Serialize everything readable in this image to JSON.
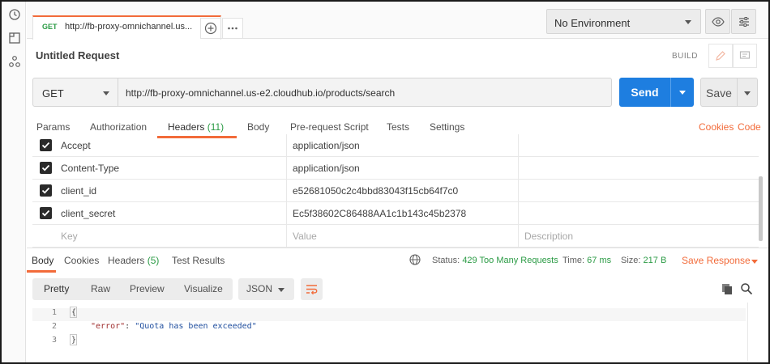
{
  "rail": {
    "icons": [
      "history-icon",
      "collection-icon",
      "apis-icon"
    ]
  },
  "tab": {
    "method": "GET",
    "url": "http://fb-proxy-omnichannel.us..."
  },
  "environment": {
    "selected": "No Environment"
  },
  "request": {
    "title": "Untitled Request",
    "build_label": "BUILD",
    "method": "GET",
    "url": "http://fb-proxy-omnichannel.us-e2.cloudhub.io/products/search",
    "send_label": "Send",
    "save_label": "Save"
  },
  "request_tabs": {
    "params": "Params",
    "authorization": "Authorization",
    "headers": "Headers",
    "headers_count": "(11)",
    "body": "Body",
    "pre_request": "Pre-request Script",
    "tests": "Tests",
    "settings": "Settings",
    "cookies": "Cookies",
    "code": "Code"
  },
  "headers": {
    "rows": [
      {
        "key": "Accept",
        "value": "application/json"
      },
      {
        "key": "Content-Type",
        "value": "application/json"
      },
      {
        "key": "client_id",
        "value": "e52681050c2c4bbd83043f15cb64f7c0"
      },
      {
        "key": "client_secret",
        "value": "Ec5f38602C86488AA1c1b143c45b2378"
      }
    ],
    "placeholder_key": "Key",
    "placeholder_value": "Value",
    "placeholder_description": "Description"
  },
  "response_tabs": {
    "body": "Body",
    "cookies": "Cookies",
    "headers": "Headers",
    "headers_count": "(5)",
    "test_results": "Test Results"
  },
  "response_status": {
    "status_label": "Status:",
    "status_value": "429 Too Many Requests",
    "time_label": "Time:",
    "time_value": "67 ms",
    "size_label": "Size:",
    "size_value": "217 B",
    "save_response": "Save Response"
  },
  "response_view": {
    "modes": [
      "Pretty",
      "Raw",
      "Preview",
      "Visualize"
    ],
    "active_mode": "Pretty",
    "format": "JSON"
  },
  "code": {
    "lines": [
      {
        "num": "1",
        "open": "{"
      },
      {
        "num": "2",
        "key": "\"error\"",
        "sep": ": ",
        "value": "\"Quota has been exceeded\""
      },
      {
        "num": "3",
        "close": "}"
      }
    ]
  },
  "colors": {
    "accent": "#f26b3a",
    "primary": "#1e7ee0",
    "success": "#2b9b45"
  }
}
